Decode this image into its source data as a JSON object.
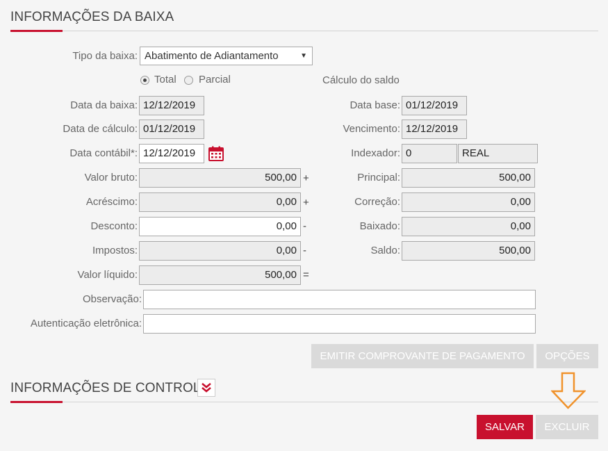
{
  "sections": {
    "baixa_title": "INFORMAÇÕES DA BAIXA",
    "controle_title": "INFORMAÇÕES DE CONTROLE"
  },
  "labels": {
    "tipo_baixa": "Tipo da baixa",
    "data_baixa": "Data da baixa",
    "data_calculo": "Data de cálculo",
    "data_contabil": "Data contábil*",
    "valor_bruto": "Valor bruto",
    "acrescimo": "Acréscimo",
    "desconto": "Desconto",
    "impostos": "Impostos",
    "valor_liquido": "Valor líquido",
    "observacao": "Observação",
    "autenticacao": "Autenticação eletrônica",
    "calculo_saldo": "Cálculo do saldo",
    "data_base": "Data base",
    "vencimento": "Vencimento",
    "indexador": "Indexador",
    "principal": "Principal",
    "correcao": "Correção",
    "baixado": "Baixado",
    "saldo": "Saldo",
    "colon": ":"
  },
  "tipo_baixa": {
    "selected": "Abatimento de Adiantamento",
    "arrow": "▼"
  },
  "radios": {
    "total": "Total",
    "parcial": "Parcial",
    "selected": "total"
  },
  "values": {
    "data_baixa": "12/12/2019",
    "data_calculo": "01/12/2019",
    "data_contabil": "12/12/2019",
    "valor_bruto": "500,00",
    "acrescimo": "0,00",
    "desconto": "0,00",
    "impostos": "0,00",
    "valor_liquido": "500,00",
    "observacao": "",
    "autenticacao": "",
    "data_base": "01/12/2019",
    "vencimento": "12/12/2019",
    "indexador_code": "0",
    "indexador_name": "REAL",
    "principal": "500,00",
    "correcao": "0,00",
    "baixado": "0,00",
    "saldo": "500,00"
  },
  "operators": {
    "valor_bruto": "+",
    "acrescimo": "+",
    "desconto": "-",
    "impostos": "-",
    "valor_liquido": "="
  },
  "buttons": {
    "emitir": "EMITIR COMPROVANTE DE PAGAMENTO",
    "opcoes": "OPÇÕES",
    "salvar": "SALVAR",
    "excluir": "EXCLUIR"
  },
  "colors": {
    "accent": "#c8102e",
    "annotation_arrow": "#f0922b",
    "disabled_button": "#dadada"
  }
}
